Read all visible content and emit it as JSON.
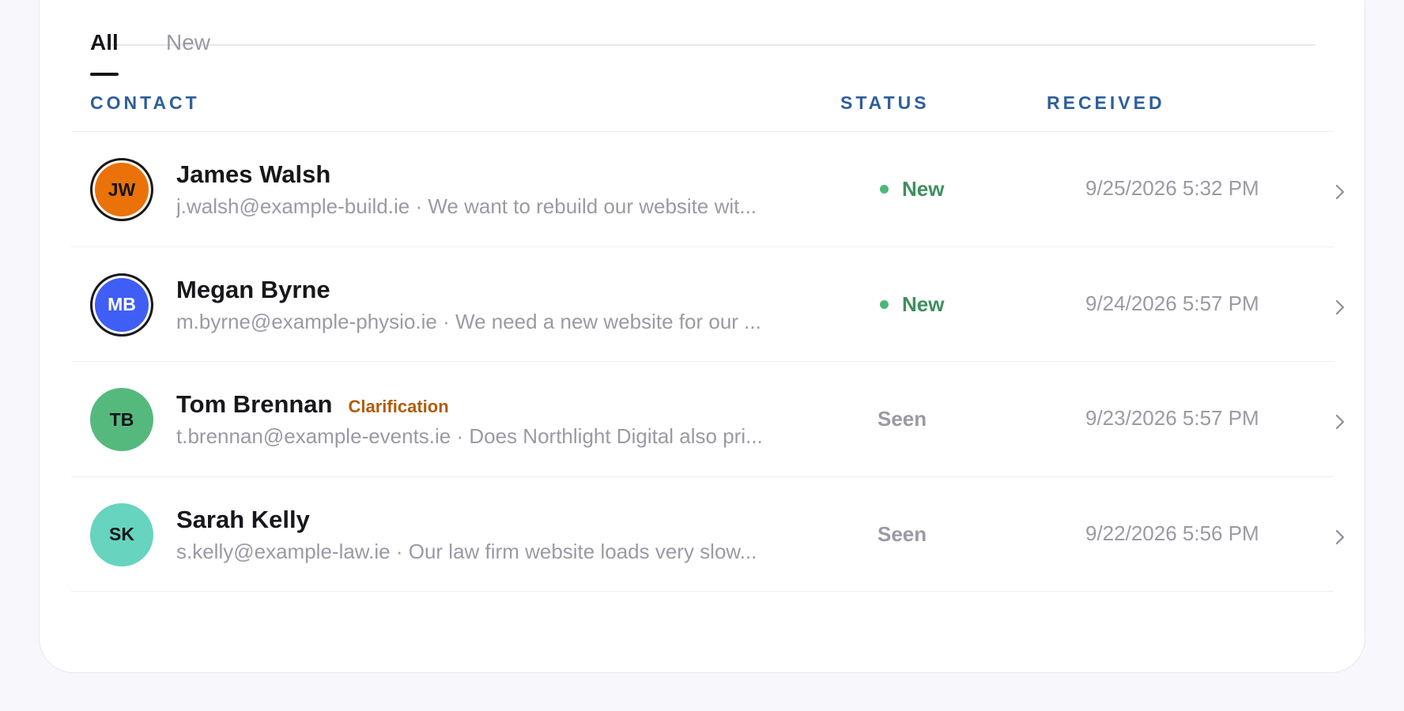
{
  "tabs": [
    {
      "label": "All",
      "active": true
    },
    {
      "label": "New",
      "active": false
    }
  ],
  "table": {
    "columns": [
      "CONTACT",
      "STATUS",
      "RECEIVED"
    ],
    "rows": [
      {
        "initials": "JW",
        "avatar_color": "#ea7208",
        "avatar_text_color": "#15151a",
        "highlighted": true,
        "name": "James Walsh",
        "tag": "",
        "email": "j.walsh@example-build.ie",
        "separator": "·",
        "preview": "We want to rebuild our website wit...",
        "status": "New",
        "status_color": "#3e8f5f",
        "dot_color": "#4bb877",
        "received": "9/25/2026 5:32 PM",
        "chevron_icon": "chevron-right-icon"
      },
      {
        "initials": "MB",
        "avatar_color": "#3f5ef5",
        "avatar_text_color": "#ffffff",
        "highlighted": true,
        "name": "Megan Byrne",
        "tag": "",
        "email": "m.byrne@example-physio.ie",
        "separator": "·",
        "preview": "We need a new website for our ...",
        "status": "New",
        "status_color": "#3e8f5f",
        "dot_color": "#4bb877",
        "received": "9/24/2026 5:57 PM",
        "chevron_icon": "chevron-right-icon"
      },
      {
        "initials": "TB",
        "avatar_color": "#55b97e",
        "avatar_text_color": "#15151a",
        "highlighted": false,
        "name": "Tom Brennan",
        "tag": "Clarification",
        "email": "t.brennan@example-events.ie",
        "separator": "·",
        "preview": "Does Northlight Digital also pri...",
        "status": "Seen",
        "status_color": "#9a9aa6",
        "dot_color": "",
        "received": "9/23/2026 5:57 PM",
        "chevron_icon": "chevron-right-icon"
      },
      {
        "initials": "SK",
        "avatar_color": "#66d4bf",
        "avatar_text_color": "#15151a",
        "highlighted": false,
        "name": "Sarah Kelly",
        "tag": "",
        "email": "s.kelly@example-law.ie",
        "separator": "·",
        "preview": "Our law firm website loads very slow...",
        "status": "Seen",
        "status_color": "#9a9aa6",
        "dot_color": "",
        "received": "9/22/2026 5:56 PM",
        "chevron_icon": "chevron-right-icon"
      }
    ]
  }
}
